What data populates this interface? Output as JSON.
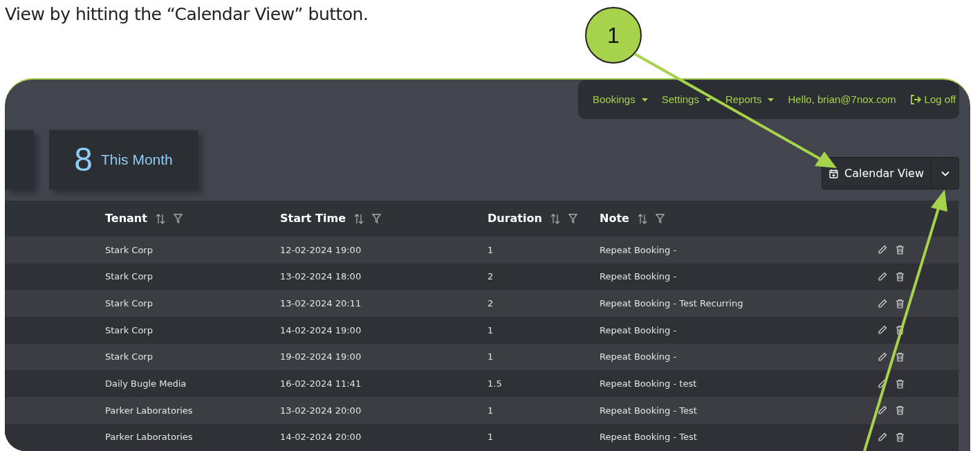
{
  "caption": "View by hitting the “Calendar View” button.",
  "callout": {
    "label": "1"
  },
  "nav": {
    "menus": [
      {
        "label": "Bookings",
        "dropdown": true
      },
      {
        "label": "Settings",
        "dropdown": true
      },
      {
        "label": "Reports",
        "dropdown": true
      },
      {
        "label": "Hello, brian@7nox.com",
        "dropdown": false
      }
    ],
    "logoff": "Log off"
  },
  "stats": [
    {
      "count": "8",
      "label": "This Month"
    }
  ],
  "calendar_button": {
    "label": "Calendar View"
  },
  "table": {
    "columns": [
      "Tenant",
      "Start Time",
      "Duration",
      "Note"
    ],
    "rows": [
      {
        "tenant": "Stark Corp",
        "start": "12-02-2024 19:00",
        "duration": "1",
        "note": "Repeat Booking -"
      },
      {
        "tenant": "Stark Corp",
        "start": "13-02-2024 18:00",
        "duration": "2",
        "note": "Repeat Booking -"
      },
      {
        "tenant": "Stark Corp",
        "start": "13-02-2024 20:11",
        "duration": "2",
        "note": "Repeat Booking - Test Recurring"
      },
      {
        "tenant": "Stark Corp",
        "start": "14-02-2024 19:00",
        "duration": "1",
        "note": "Repeat Booking -"
      },
      {
        "tenant": "Stark Corp",
        "start": "19-02-2024 19:00",
        "duration": "1",
        "note": "Repeat Booking -"
      },
      {
        "tenant": "Daily Bugle Media",
        "start": "16-02-2024 11:41",
        "duration": "1.5",
        "note": "Repeat Booking - test"
      },
      {
        "tenant": "Parker Laboratories",
        "start": "13-02-2024 20:00",
        "duration": "1",
        "note": "Repeat Booking - Test"
      },
      {
        "tenant": "Parker Laboratories",
        "start": "14-02-2024 20:00",
        "duration": "1",
        "note": "Repeat Booking - Test"
      }
    ]
  }
}
